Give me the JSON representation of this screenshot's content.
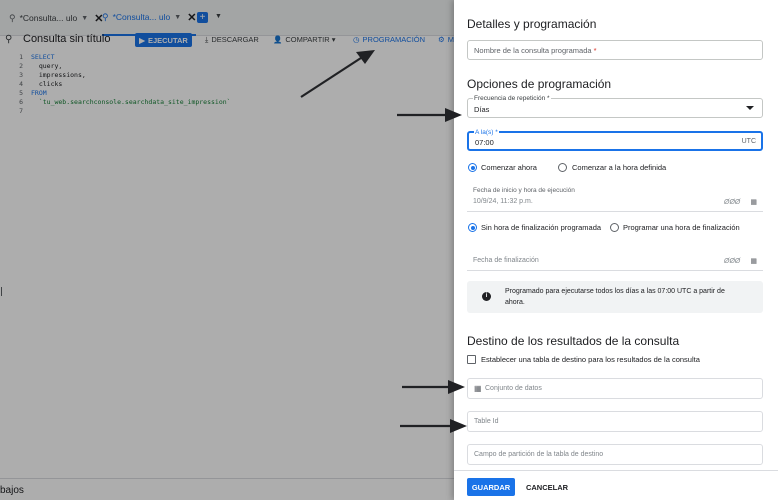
{
  "tabs": [
    {
      "label": "*Consulta... ulo",
      "icon": "search-icon",
      "active": false
    },
    {
      "label": "*Consulta... ulo",
      "icon": "search-icon",
      "active": true
    }
  ],
  "toolbar": {
    "query_title": "Consulta sin título",
    "run_label": "EJECUTAR",
    "download_label": "DESCARGAR",
    "share_label": "COMPARTIR",
    "schedule_label": "PROGRAMACIÓN",
    "more_label": "M"
  },
  "editor": {
    "line_numbers": [
      "1",
      "2",
      "3",
      "4",
      "5",
      "6",
      "7"
    ],
    "lines": [
      {
        "kw": "SELECT",
        "text": ""
      },
      {
        "kw": "",
        "text": "  query,"
      },
      {
        "kw": "",
        "text": "  impressions,"
      },
      {
        "kw": "",
        "text": "  clicks"
      },
      {
        "kw": "FROM",
        "text": ""
      },
      {
        "kw": "",
        "text": "  `tu_web.searchconsole.searchdata_site_impression`"
      },
      {
        "kw": "",
        "text": ""
      }
    ]
  },
  "bottom_label": "bajos",
  "panel": {
    "title": "Detalles y programación",
    "name_placeholder": "Nombre de la consulta programada",
    "required_mark": "*",
    "schedule_section_title": "Opciones de programación",
    "frequency_label": "Frecuencia de repetición",
    "frequency_value": "Días",
    "time_label": "A la(s)",
    "time_value": "07:00",
    "time_zone": "UTC",
    "start_now_label": "Comenzar ahora",
    "start_at_label": "Comenzar a la hora definida",
    "start_datetime_label": "Fecha de inicio y hora de ejecución",
    "start_datetime_value": "10/9/24, 11:32 p.m.",
    "time_icon_glyph": "ØØØ",
    "no_end_label": "Sin hora de finalización programada",
    "schedule_end_label": "Programar una hora de finalización",
    "end_date_placeholder": "Fecha de finalización",
    "info_text": "Programado para ejecutarse todos los días a las 07:00 UTC a partir de ahora.",
    "dest_section_title": "Destino de los resultados de la consulta",
    "dest_checkbox_label": "Establecer una tabla de destino para los resultados de la consulta",
    "dataset_placeholder": "Conjunto de datos",
    "table_id_placeholder": "Table Id",
    "partition_placeholder": "Campo de partición de la tabla de destino",
    "save_label": "GUARDAR",
    "cancel_label": "CANCELAR"
  },
  "colors": {
    "accent": "#1a73e8",
    "required": "#d93025",
    "info_bg": "#f1f3f4"
  }
}
